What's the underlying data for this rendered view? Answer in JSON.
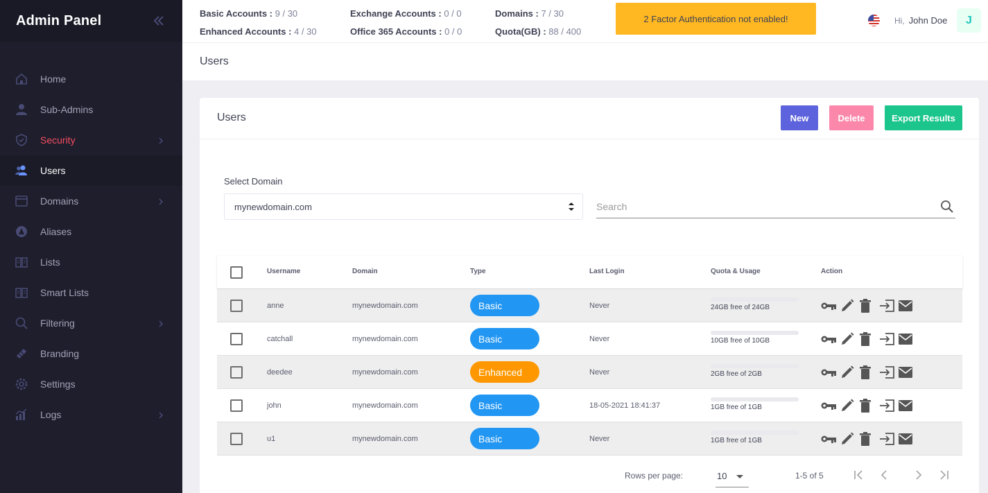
{
  "app": {
    "title": "Admin Panel"
  },
  "sidebar": {
    "items": [
      {
        "label": "Home",
        "icon": "home-icon",
        "submenu": false
      },
      {
        "label": "Sub-Admins",
        "icon": "user-icon",
        "submenu": false
      },
      {
        "label": "Security",
        "icon": "shield-icon",
        "submenu": true
      },
      {
        "label": "Users",
        "icon": "users-icon",
        "submenu": false,
        "active": true
      },
      {
        "label": "Domains",
        "icon": "window-icon",
        "submenu": true
      },
      {
        "label": "Aliases",
        "icon": "alias-icon",
        "submenu": false
      },
      {
        "label": "Lists",
        "icon": "book-icon",
        "submenu": false
      },
      {
        "label": "Smart Lists",
        "icon": "book-icon",
        "submenu": false
      },
      {
        "label": "Filtering",
        "icon": "search-icon",
        "submenu": true
      },
      {
        "label": "Branding",
        "icon": "brush-icon",
        "submenu": false
      },
      {
        "label": "Settings",
        "icon": "gear-icon",
        "submenu": false
      },
      {
        "label": "Logs",
        "icon": "chart-icon",
        "submenu": true
      }
    ]
  },
  "header": {
    "stats": {
      "basic_label": "Basic Accounts :",
      "basic_value": "9 / 30",
      "enhanced_label": "Enhanced Accounts :",
      "enhanced_value": "4 / 30",
      "exchange_label": "Exchange Accounts :",
      "exchange_value": "0 / 0",
      "office_label": "Office 365 Accounts :",
      "office_value": "0 / 0",
      "domains_label": "Domains :",
      "domains_value": "7 / 30",
      "quota_label": "Quota(GB) :",
      "quota_value": "88 / 400"
    },
    "alert": "2 Factor Authentication not enabled!",
    "greeting": "Hi,",
    "user_name": "John Doe",
    "avatar_letter": "J"
  },
  "subheader": {
    "title": "Users"
  },
  "card": {
    "title": "Users",
    "buttons": {
      "new": "New",
      "delete": "Delete",
      "export": "Export Results"
    },
    "domain_label": "Select Domain",
    "domain_value": "mynewdomain.com",
    "search_placeholder": "Search"
  },
  "table": {
    "headers": {
      "username": "Username",
      "domain": "Domain",
      "type": "Type",
      "last_login": "Last Login",
      "quota": "Quota & Usage",
      "action": "Action"
    },
    "rows": [
      {
        "username": "anne",
        "domain": "mynewdomain.com",
        "type": "Basic",
        "last_login": "Never",
        "quota": "24GB free of 24GB",
        "usage": 0
      },
      {
        "username": "catchall",
        "domain": "mynewdomain.com",
        "type": "Basic",
        "last_login": "Never",
        "quota": "10GB free of 10GB",
        "usage": 0
      },
      {
        "username": "deedee",
        "domain": "mynewdomain.com",
        "type": "Enhanced",
        "last_login": "Never",
        "quota": "2GB free of 2GB",
        "usage": 0
      },
      {
        "username": "john",
        "domain": "mynewdomain.com",
        "type": "Basic",
        "last_login": "18-05-2021 18:41:37",
        "quota": "1GB free of 1GB",
        "usage": 0
      },
      {
        "username": "u1",
        "domain": "mynewdomain.com",
        "type": "Basic",
        "last_login": "Never",
        "quota": "1GB free of 1GB",
        "usage": 0
      }
    ]
  },
  "pagination": {
    "rows_per_page_label": "Rows per page:",
    "rows_per_page": "10",
    "range": "1-5 of 5"
  },
  "colors": {
    "basic": "#2196f3",
    "enhanced": "#ff9800",
    "active_nav": "#6993ff",
    "security": "#f64e60"
  }
}
